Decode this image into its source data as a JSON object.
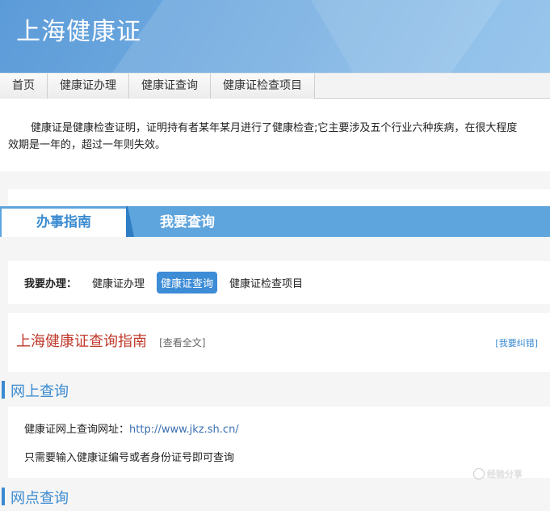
{
  "header": {
    "title": "上海健康证"
  },
  "nav": {
    "items": [
      "首页",
      "健康证办理",
      "健康证查询",
      "健康证检查项目"
    ]
  },
  "intro": {
    "line1": "健康证是健康检查证明，证明持有者某年某月进行了健康检查;它主要涉及五个行业六种疾病，在很大程度",
    "line2": "效期是一年的，超过一年则失效。"
  },
  "tabs": {
    "active": "办事指南",
    "other": "我要查询"
  },
  "selector": {
    "label": "我要办理：",
    "options": [
      "健康证办理",
      "健康证查询",
      "健康证检查项目"
    ],
    "active_index": 1
  },
  "guide": {
    "title": "上海健康证查询指南",
    "view_all": "[查看全文]",
    "report": "[我要纠错]"
  },
  "sections": {
    "online": "网上查询",
    "outlet": "网点查询"
  },
  "online": {
    "url_label": "健康证网上查询网址：",
    "url": "http://www.jkz.sh.cn/",
    "note": "只需要输入健康证编号或者身份证号即可查询"
  },
  "watermark": {
    "text": "经验分享"
  },
  "colors": {
    "accent": "#3a8ad0",
    "header": "#6fa9df",
    "guide_title": "#c0392b"
  }
}
